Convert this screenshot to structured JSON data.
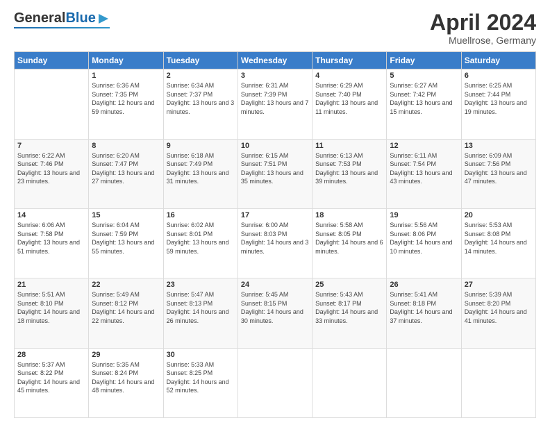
{
  "header": {
    "logo_general": "General",
    "logo_blue": "Blue",
    "title": "April 2024",
    "location": "Muellrose, Germany"
  },
  "days_of_week": [
    "Sunday",
    "Monday",
    "Tuesday",
    "Wednesday",
    "Thursday",
    "Friday",
    "Saturday"
  ],
  "weeks": [
    [
      {
        "day": "",
        "sunrise": "",
        "sunset": "",
        "daylight": ""
      },
      {
        "day": "1",
        "sunrise": "Sunrise: 6:36 AM",
        "sunset": "Sunset: 7:35 PM",
        "daylight": "Daylight: 12 hours and 59 minutes."
      },
      {
        "day": "2",
        "sunrise": "Sunrise: 6:34 AM",
        "sunset": "Sunset: 7:37 PM",
        "daylight": "Daylight: 13 hours and 3 minutes."
      },
      {
        "day": "3",
        "sunrise": "Sunrise: 6:31 AM",
        "sunset": "Sunset: 7:39 PM",
        "daylight": "Daylight: 13 hours and 7 minutes."
      },
      {
        "day": "4",
        "sunrise": "Sunrise: 6:29 AM",
        "sunset": "Sunset: 7:40 PM",
        "daylight": "Daylight: 13 hours and 11 minutes."
      },
      {
        "day": "5",
        "sunrise": "Sunrise: 6:27 AM",
        "sunset": "Sunset: 7:42 PM",
        "daylight": "Daylight: 13 hours and 15 minutes."
      },
      {
        "day": "6",
        "sunrise": "Sunrise: 6:25 AM",
        "sunset": "Sunset: 7:44 PM",
        "daylight": "Daylight: 13 hours and 19 minutes."
      }
    ],
    [
      {
        "day": "7",
        "sunrise": "Sunrise: 6:22 AM",
        "sunset": "Sunset: 7:46 PM",
        "daylight": "Daylight: 13 hours and 23 minutes."
      },
      {
        "day": "8",
        "sunrise": "Sunrise: 6:20 AM",
        "sunset": "Sunset: 7:47 PM",
        "daylight": "Daylight: 13 hours and 27 minutes."
      },
      {
        "day": "9",
        "sunrise": "Sunrise: 6:18 AM",
        "sunset": "Sunset: 7:49 PM",
        "daylight": "Daylight: 13 hours and 31 minutes."
      },
      {
        "day": "10",
        "sunrise": "Sunrise: 6:15 AM",
        "sunset": "Sunset: 7:51 PM",
        "daylight": "Daylight: 13 hours and 35 minutes."
      },
      {
        "day": "11",
        "sunrise": "Sunrise: 6:13 AM",
        "sunset": "Sunset: 7:53 PM",
        "daylight": "Daylight: 13 hours and 39 minutes."
      },
      {
        "day": "12",
        "sunrise": "Sunrise: 6:11 AM",
        "sunset": "Sunset: 7:54 PM",
        "daylight": "Daylight: 13 hours and 43 minutes."
      },
      {
        "day": "13",
        "sunrise": "Sunrise: 6:09 AM",
        "sunset": "Sunset: 7:56 PM",
        "daylight": "Daylight: 13 hours and 47 minutes."
      }
    ],
    [
      {
        "day": "14",
        "sunrise": "Sunrise: 6:06 AM",
        "sunset": "Sunset: 7:58 PM",
        "daylight": "Daylight: 13 hours and 51 minutes."
      },
      {
        "day": "15",
        "sunrise": "Sunrise: 6:04 AM",
        "sunset": "Sunset: 7:59 PM",
        "daylight": "Daylight: 13 hours and 55 minutes."
      },
      {
        "day": "16",
        "sunrise": "Sunrise: 6:02 AM",
        "sunset": "Sunset: 8:01 PM",
        "daylight": "Daylight: 13 hours and 59 minutes."
      },
      {
        "day": "17",
        "sunrise": "Sunrise: 6:00 AM",
        "sunset": "Sunset: 8:03 PM",
        "daylight": "Daylight: 14 hours and 3 minutes."
      },
      {
        "day": "18",
        "sunrise": "Sunrise: 5:58 AM",
        "sunset": "Sunset: 8:05 PM",
        "daylight": "Daylight: 14 hours and 6 minutes."
      },
      {
        "day": "19",
        "sunrise": "Sunrise: 5:56 AM",
        "sunset": "Sunset: 8:06 PM",
        "daylight": "Daylight: 14 hours and 10 minutes."
      },
      {
        "day": "20",
        "sunrise": "Sunrise: 5:53 AM",
        "sunset": "Sunset: 8:08 PM",
        "daylight": "Daylight: 14 hours and 14 minutes."
      }
    ],
    [
      {
        "day": "21",
        "sunrise": "Sunrise: 5:51 AM",
        "sunset": "Sunset: 8:10 PM",
        "daylight": "Daylight: 14 hours and 18 minutes."
      },
      {
        "day": "22",
        "sunrise": "Sunrise: 5:49 AM",
        "sunset": "Sunset: 8:12 PM",
        "daylight": "Daylight: 14 hours and 22 minutes."
      },
      {
        "day": "23",
        "sunrise": "Sunrise: 5:47 AM",
        "sunset": "Sunset: 8:13 PM",
        "daylight": "Daylight: 14 hours and 26 minutes."
      },
      {
        "day": "24",
        "sunrise": "Sunrise: 5:45 AM",
        "sunset": "Sunset: 8:15 PM",
        "daylight": "Daylight: 14 hours and 30 minutes."
      },
      {
        "day": "25",
        "sunrise": "Sunrise: 5:43 AM",
        "sunset": "Sunset: 8:17 PM",
        "daylight": "Daylight: 14 hours and 33 minutes."
      },
      {
        "day": "26",
        "sunrise": "Sunrise: 5:41 AM",
        "sunset": "Sunset: 8:18 PM",
        "daylight": "Daylight: 14 hours and 37 minutes."
      },
      {
        "day": "27",
        "sunrise": "Sunrise: 5:39 AM",
        "sunset": "Sunset: 8:20 PM",
        "daylight": "Daylight: 14 hours and 41 minutes."
      }
    ],
    [
      {
        "day": "28",
        "sunrise": "Sunrise: 5:37 AM",
        "sunset": "Sunset: 8:22 PM",
        "daylight": "Daylight: 14 hours and 45 minutes."
      },
      {
        "day": "29",
        "sunrise": "Sunrise: 5:35 AM",
        "sunset": "Sunset: 8:24 PM",
        "daylight": "Daylight: 14 hours and 48 minutes."
      },
      {
        "day": "30",
        "sunrise": "Sunrise: 5:33 AM",
        "sunset": "Sunset: 8:25 PM",
        "daylight": "Daylight: 14 hours and 52 minutes."
      },
      {
        "day": "",
        "sunrise": "",
        "sunset": "",
        "daylight": ""
      },
      {
        "day": "",
        "sunrise": "",
        "sunset": "",
        "daylight": ""
      },
      {
        "day": "",
        "sunrise": "",
        "sunset": "",
        "daylight": ""
      },
      {
        "day": "",
        "sunrise": "",
        "sunset": "",
        "daylight": ""
      }
    ]
  ]
}
